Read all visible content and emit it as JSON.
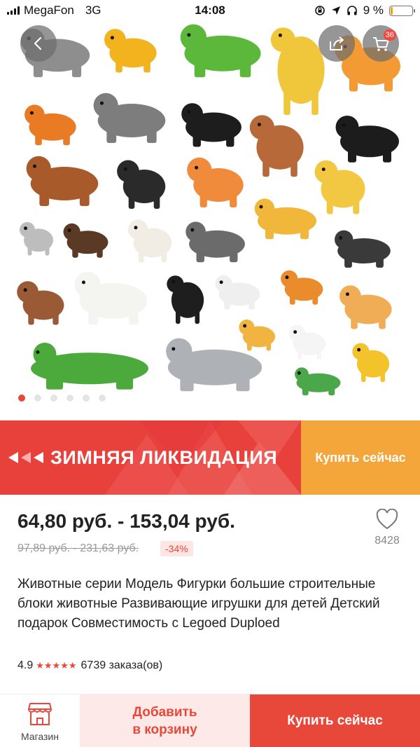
{
  "status_bar": {
    "carrier": "MegaFon",
    "network": "3G",
    "time": "14:08",
    "battery": "9 %",
    "battery_level": 0.09
  },
  "gallery": {
    "cart_count": "36",
    "image_count": 6,
    "active_index": 0,
    "icons": [
      "chevron-left-icon",
      "share-icon",
      "cart-icon"
    ],
    "animals": [
      "elephant",
      "cockerel",
      "triceratops",
      "giraffe",
      "dinosaur",
      "tiger",
      "hippo",
      "panther",
      "deer",
      "horse",
      "horse",
      "monkey",
      "dino",
      "giraffe",
      "lioness",
      "cat",
      "puppy",
      "cow",
      "elephant",
      "zebra",
      "dog",
      "horse",
      "penguin",
      "kitten",
      "tiger-cub",
      "lion",
      "bear",
      "dalmatian",
      "crocodile",
      "whale",
      "hen",
      "turtle"
    ]
  },
  "promo": {
    "title": "ЗИМНЯЯ ЛИКВИДАЦИЯ",
    "cta": "Купить сейчас",
    "colors": {
      "red": "#e8413c",
      "orange": "#f5a63a"
    }
  },
  "price": {
    "current": "64,80 руб. - 153,04 руб.",
    "old": "97,89 руб. - 231,63 руб.",
    "discount": "-34%"
  },
  "wishlist": {
    "count": "8428",
    "icon": "heart-icon"
  },
  "product": {
    "title": "Животные серии Модель Фигурки большие строительные блоки животные Развивающие игрушки для детей Детский подарок Совместимость с Legoed Duploed",
    "rating": "4.9",
    "stars": "★★★★★",
    "orders": "6739 заказа(ов)"
  },
  "bottom_bar": {
    "store_label": "Магазин",
    "add_to_cart_line1": "Добавить",
    "add_to_cart_line2": "в корзину",
    "buy_now": "Купить сейчас"
  },
  "colors": {
    "accent": "#e8483a",
    "accent_light": "#fde9e7"
  }
}
